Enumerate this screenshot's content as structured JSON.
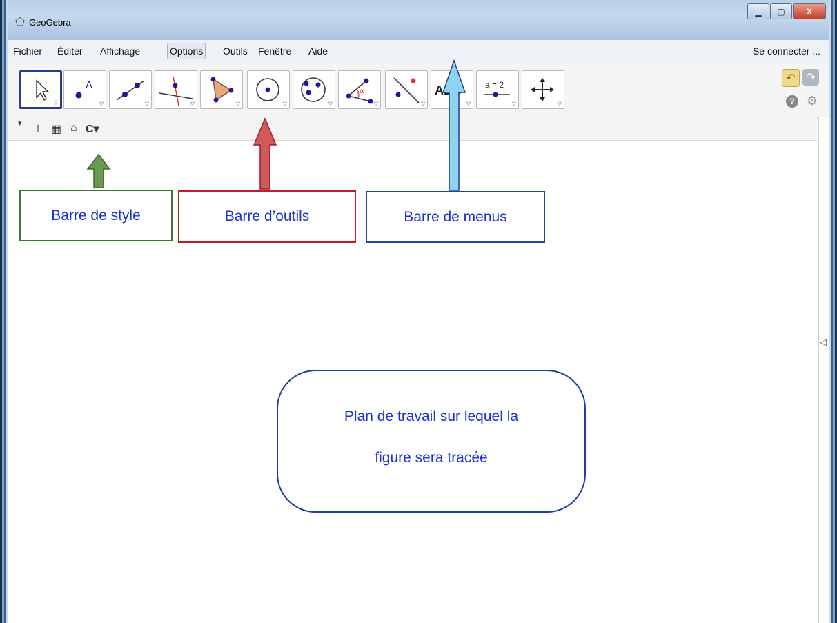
{
  "window": {
    "title": "GeoGebra",
    "app_icon": "geogebra-icon",
    "buttons": {
      "minimize": "▁",
      "maximize": "▢",
      "close": "X"
    }
  },
  "menubar": {
    "items": [
      "Fichier",
      "Éditer",
      "Affichage",
      "Options",
      "Outils",
      "Fenêtre",
      "Aide"
    ],
    "selected": "Options",
    "login_label": "Se connecter ..."
  },
  "toolbar": {
    "tools": [
      {
        "name": "move-tool-icon",
        "active": true
      },
      {
        "name": "point-tool-icon",
        "label": "A"
      },
      {
        "name": "line-tool-icon"
      },
      {
        "name": "perpendicular-tool-icon"
      },
      {
        "name": "polygon-tool-icon"
      },
      {
        "name": "circle-tool-icon"
      },
      {
        "name": "conic-tool-icon"
      },
      {
        "name": "angle-tool-icon",
        "label": "α"
      },
      {
        "name": "reflect-tool-icon"
      },
      {
        "name": "text-tool-icon",
        "label": "ABC"
      },
      {
        "name": "slider-tool-icon",
        "label": "a = 2"
      },
      {
        "name": "move-view-tool-icon"
      }
    ],
    "undo_icon": "undo-icon",
    "redo_icon": "redo-icon",
    "help_icon": "help-icon",
    "settings_icon": "gear-icon",
    "help_glyph": "?",
    "settings_glyph": "⚙"
  },
  "stylebar": {
    "icons": [
      "toggle-arrow-icon",
      "axes-icon",
      "grid-icon",
      "home-icon",
      "point-capture-icon"
    ],
    "glyphs": {
      "toggle": "▾",
      "axes": "⊥",
      "grid": "▦",
      "home": "⌂",
      "capture": "C▾"
    }
  },
  "annotations": {
    "style_bar": "Barre de style",
    "toolbar": "Barre d’outils",
    "menu_bar": "Barre de menus",
    "workspace_line1": "Plan de travail sur lequel la",
    "workspace_line2": "figure sera tracée"
  },
  "colors": {
    "green_arrow": "#6a9a4e",
    "red_arrow": "#d0595b",
    "blue_arrow": "#8ed3f0",
    "annotation_text": "#1c2fd8"
  }
}
